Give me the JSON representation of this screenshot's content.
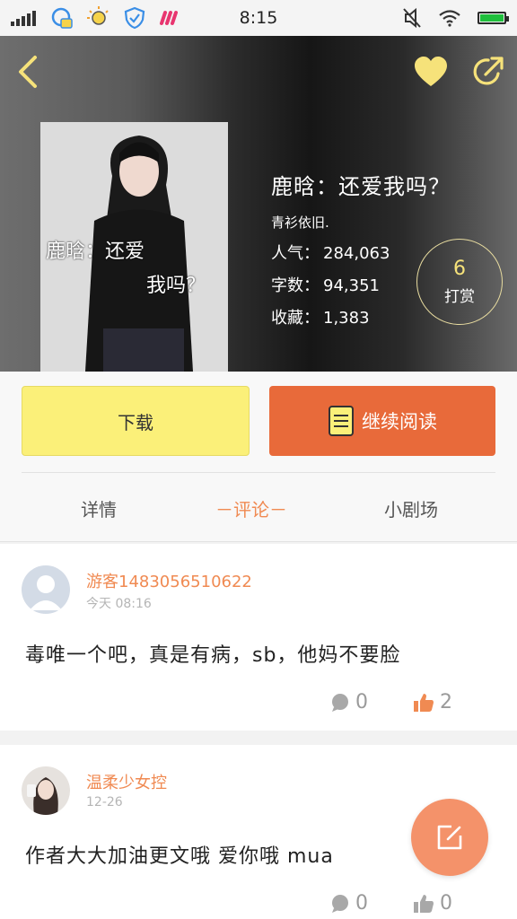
{
  "status_bar": {
    "time": "8:15",
    "icons": [
      "signal-icon",
      "assistant-icon",
      "bulb-icon",
      "shield-check-icon",
      "app-icon",
      "mute-icon",
      "wifi-icon",
      "battery-icon"
    ]
  },
  "header": {
    "back_icon": "chevron-left-icon",
    "favorite_icon": "heart-icon",
    "share_icon": "share-icon",
    "accent_color": "#f6e27a"
  },
  "book": {
    "cover_text_line1": "鹿晗：还爱",
    "cover_text_line2": "我吗？",
    "title": "鹿晗：还爱我吗？",
    "author": "青衫依旧.",
    "stats": [
      {
        "label": "人气：",
        "value": "284,063"
      },
      {
        "label": "字数：",
        "value": "94,351"
      },
      {
        "label": "收藏：",
        "value": "1,383"
      }
    ],
    "tip": {
      "count": "6",
      "label": "打赏"
    }
  },
  "actions": {
    "download_label": "下载",
    "continue_label": "继续阅读",
    "continue_icon": "book-icon",
    "download_color": "#fbf079",
    "continue_color": "#e86a3a"
  },
  "tabs": [
    {
      "label": "详情",
      "active": false
    },
    {
      "label": "－评论－",
      "active": true
    },
    {
      "label": "小剧场",
      "active": false
    }
  ],
  "comments": [
    {
      "username": "游客1483056510622",
      "time": "今天 08:16",
      "text": "毒唯一个吧，真是有病，sb，他妈不要脸",
      "replies": "0",
      "likes": "2",
      "liked": true
    },
    {
      "username": "温柔少女控",
      "time": "12-26",
      "text": "作者大大加油更文哦   爱你哦  mua",
      "replies": "0",
      "likes": "0",
      "liked": false
    }
  ],
  "fab": {
    "icon": "edit-icon",
    "color": "#f4926a"
  }
}
